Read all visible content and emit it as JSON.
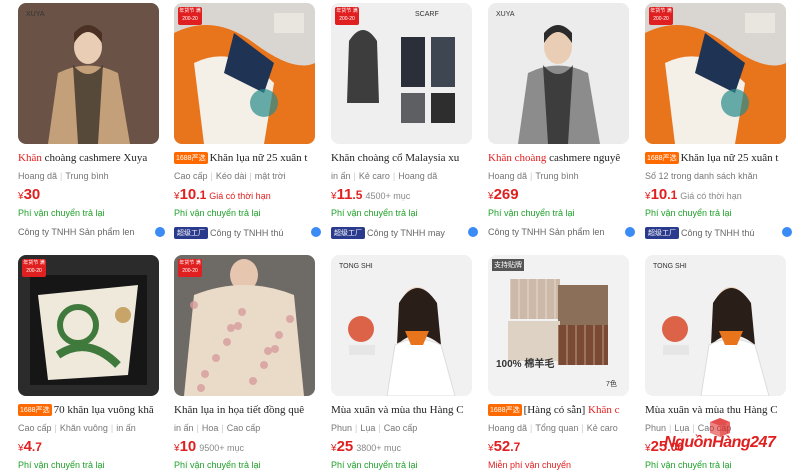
{
  "products": [
    {
      "title_highlight": "Khăn",
      "title_rest": " choàng cashmere Xuya",
      "badge": "",
      "tags": [
        "Hoang dã",
        "Trung bình"
      ],
      "price": "30",
      "price_note": "",
      "price_note_red": false,
      "shipping": "Phí vận chuyển trả lại",
      "shipping_red": false,
      "company": "Công ty TNHH Sản phẩm len",
      "factory_badge": "",
      "promo": "",
      "brand_text": "XUYA",
      "colors": {
        "bg": "#6a5346",
        "main": "#c4a07a",
        "accent": "#2a2320"
      }
    },
    {
      "title_highlight": "",
      "title_rest": "Khăn lụa nữ 25 xuân t",
      "badge": "1688严选",
      "tags": [
        "Cao cấp",
        "Kéo dài",
        "mật trời"
      ],
      "price": "10",
      "price_decimal": ".1",
      "price_note": "Giá có thời hạn",
      "price_note_red": true,
      "shipping": "Phí vận chuyển trả lại",
      "shipping_red": false,
      "company": "Công ty TNHH thú",
      "factory_badge": "超级工厂",
      "promo": "年货节 满200-20",
      "brand_text": "",
      "colors": {
        "bg": "#d9d6d2",
        "main": "#e8741c",
        "accent": "#1f3355"
      }
    },
    {
      "title_highlight": "",
      "title_rest": "Khăn choàng cổ Malaysia xu",
      "badge": "",
      "tags": [
        "in ấn",
        "Kẻ caro",
        "Hoang dã"
      ],
      "price": "11",
      "price_decimal": ".5",
      "price_note": "4500+ mục",
      "price_note_red": false,
      "shipping": "Phí vận chuyển trả lại",
      "shipping_red": false,
      "company": "Công ty TNHH may",
      "factory_badge": "超级工厂",
      "promo": "年货节 满200-20",
      "brand_text": "SCARF",
      "colors": {
        "bg": "#efefef",
        "main": "#4a4a4a",
        "accent": "#1a1a1a"
      }
    },
    {
      "title_highlight": "Khăn choàng",
      "title_rest": " cashmere nguyê",
      "badge": "",
      "tags": [
        "Hoang dã",
        "Trung bình"
      ],
      "price": "269",
      "price_note": "",
      "price_note_red": false,
      "shipping": "Phí vận chuyển trả lại",
      "shipping_red": false,
      "company": "Công ty TNHH Sản phẩm len",
      "factory_badge": "",
      "promo": "",
      "brand_text": "XUYA",
      "colors": {
        "bg": "#ececec",
        "main": "#8c8c8c",
        "accent": "#1b1b1b"
      }
    },
    {
      "title_highlight": "",
      "title_rest": "Khăn lụa nữ 25 xuân t",
      "badge": "1688严选",
      "tags": [
        "Số 12 trong danh sách khăn"
      ],
      "price": "10",
      "price_decimal": ".1",
      "price_note": "Giá có thời hạn",
      "price_note_red": false,
      "shipping": "Phí vận chuyển trả lại",
      "shipping_red": false,
      "company": "Công ty TNHH thú",
      "factory_badge": "超级工厂",
      "promo": "年货节 满200-20",
      "brand_text": "",
      "colors": {
        "bg": "#d9d6d2",
        "main": "#e8741c",
        "accent": "#1f3355"
      }
    },
    {
      "title_highlight": "",
      "title_rest": "70 khăn lụa vuông khă",
      "badge": "1688严选",
      "tags": [
        "Cao cấp",
        "Khăn vuông",
        "in ấn"
      ],
      "price": "4",
      "price_decimal": ".7",
      "price_note": "",
      "price_note_red": false,
      "shipping": "Phí vận chuyển trả lại",
      "shipping_red": false,
      "company": "",
      "factory_badge": "",
      "promo": "年货节 满200-20",
      "brand_text": "",
      "colors": {
        "bg": "#2b2b2b",
        "main": "#efe9dc",
        "accent": "#3f7a3c"
      }
    },
    {
      "title_highlight": "",
      "title_rest": "Khăn lụa in họa tiết đồng quê",
      "badge": "",
      "tags": [
        "in ấn",
        "Hoa",
        "Cao cấp"
      ],
      "price": "10",
      "price_note": "9500+ mục",
      "price_note_red": false,
      "shipping": "Phí vận chuyển trả lại",
      "shipping_red": false,
      "company": "",
      "factory_badge": "",
      "promo": "年货节 满200-20",
      "brand_text": "",
      "colors": {
        "bg": "#6e6a66",
        "main": "#eadbc8",
        "accent": "#d79c9c"
      }
    },
    {
      "title_highlight": "",
      "title_rest": "Mùa xuân và mùa thu Hàng C",
      "badge": "",
      "tags": [
        "Phun",
        "Lụa",
        "Cao cấp"
      ],
      "price": "25",
      "price_note": "3800+ mục",
      "price_note_red": false,
      "shipping": "Phí vận chuyển trả lại",
      "shipping_red": false,
      "company": "",
      "factory_badge": "",
      "promo": "",
      "brand_text": "TONG SHI",
      "colors": {
        "bg": "#f1f1f1",
        "main": "#f4f4f4",
        "accent": "#e8741c"
      }
    },
    {
      "title_highlight": "Khăn c",
      "title_rest": "[Hàng có sẵn] ",
      "badge": "1688严选",
      "tags": [
        "Hoang dã",
        "Tổng quan",
        "Kẻ caro"
      ],
      "price": "52",
      "price_decimal": ".7",
      "price_note": "",
      "price_note_red": false,
      "shipping": "Miễn phí vận chuyển",
      "shipping_red": true,
      "company": "",
      "factory_badge": "",
      "promo": "",
      "brand_text": "100% 棉羊毛",
      "colors": {
        "bg": "#f2f2f2",
        "main": "#b79b82",
        "accent": "#7a4a35"
      }
    },
    {
      "title_highlight": "",
      "title_rest": "Mùa xuân và mùa thu Hàng C",
      "badge": "",
      "tags": [
        "Phun",
        "Lụa",
        "Cao cấp"
      ],
      "price": "25",
      "price_decimal": ".00",
      "price_note": "",
      "price_note_red": false,
      "shipping": "Phí vận chuyển trả lại",
      "shipping_red": false,
      "company": "",
      "factory_badge": "",
      "promo": "",
      "brand_text": "TONG SHI",
      "colors": {
        "bg": "#f1f1f1",
        "main": "#f4f4f4",
        "accent": "#e8741c"
      }
    }
  ],
  "labels": {
    "currency": "¥",
    "support_tag": "支持贴牌",
    "color_count": "7色"
  },
  "watermark": {
    "text": "NguồnHàng247",
    "color": "#e02020"
  }
}
